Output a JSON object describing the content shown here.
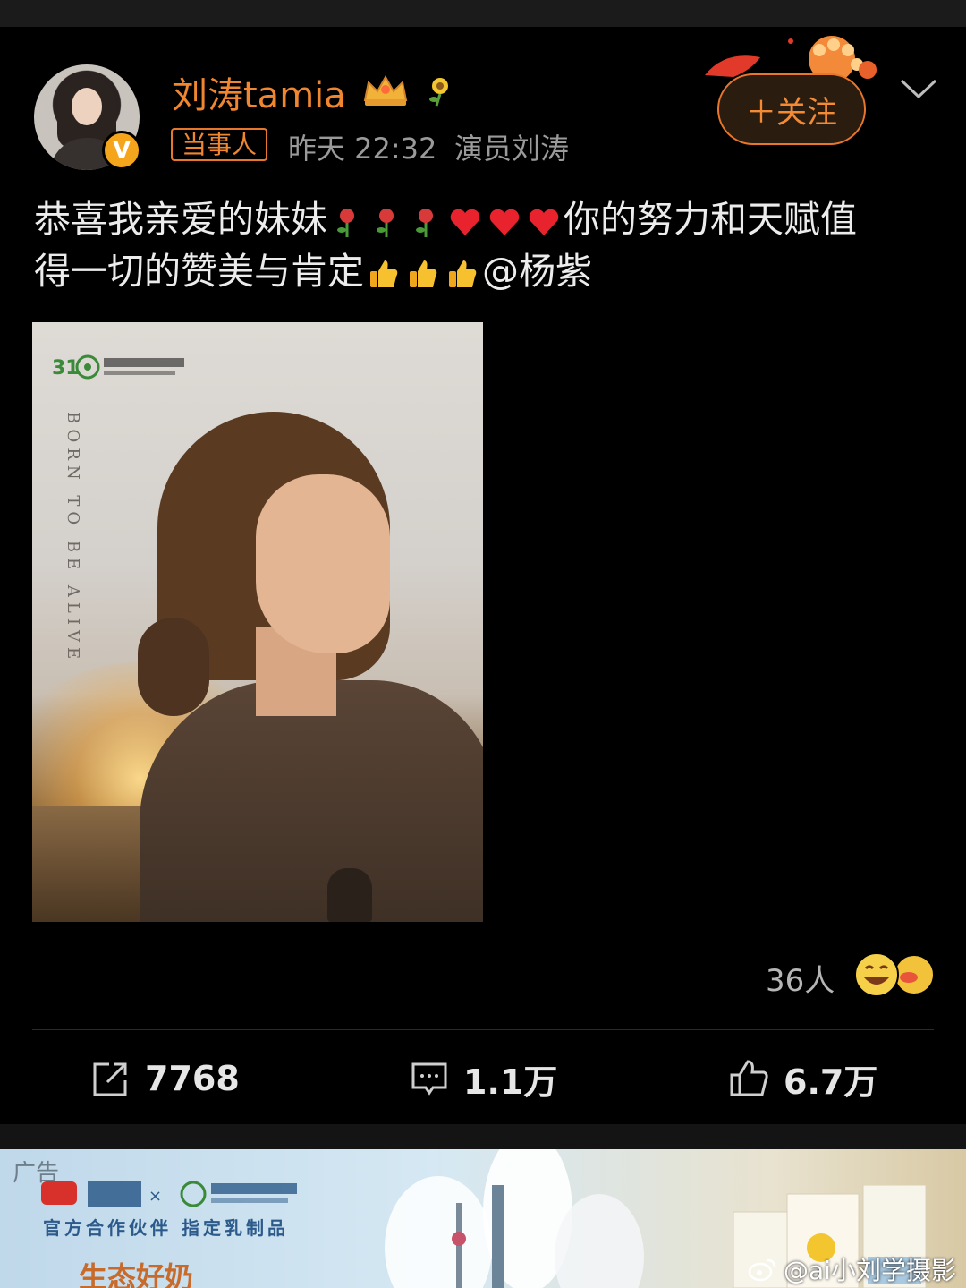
{
  "post": {
    "author": {
      "name": "刘涛tamia",
      "party_tag": "当事人",
      "time": "昨天 22:32",
      "source": "演员刘涛",
      "verified_icon": "verified-v-icon",
      "verified_glyph": "V"
    },
    "follow_button": "＋关注",
    "text_line1_a": "恭喜我亲爱的妹妹",
    "text_line1_b": "你的努力和天赋值",
    "text_line2_a": "得一切的赞美与肯定",
    "text_line2_b": "@杨紫",
    "image": {
      "vertical_text": "BORN TO BE ALIVE",
      "logo_alt": "31 上海电视节 SHANGHAI TV FESTIVAL"
    },
    "reactions": {
      "count": "36人"
    },
    "actions": {
      "repost": "7768",
      "comment": "1.1万",
      "like": "6.7万"
    }
  },
  "ad": {
    "label": "广告",
    "partner_text": "官方合作伙伴  指定乳制品",
    "slogan": "生态好奶"
  },
  "watermark": "@ai小刘学摄影",
  "colors": {
    "accent_orange": "#f0862f",
    "background": "#000000",
    "muted_text": "#9a9a9a"
  }
}
